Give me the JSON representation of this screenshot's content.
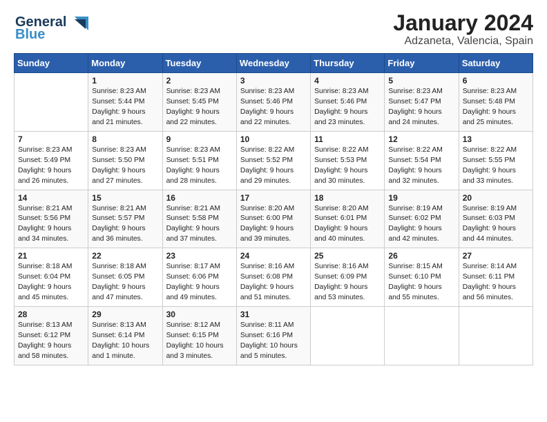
{
  "header": {
    "logo_text_1": "General",
    "logo_text_2": "Blue",
    "month": "January 2024",
    "location": "Adzaneta, Valencia, Spain"
  },
  "weekdays": [
    "Sunday",
    "Monday",
    "Tuesday",
    "Wednesday",
    "Thursday",
    "Friday",
    "Saturday"
  ],
  "weeks": [
    [
      {
        "day": "",
        "info": ""
      },
      {
        "day": "1",
        "info": "Sunrise: 8:23 AM\nSunset: 5:44 PM\nDaylight: 9 hours\nand 21 minutes."
      },
      {
        "day": "2",
        "info": "Sunrise: 8:23 AM\nSunset: 5:45 PM\nDaylight: 9 hours\nand 22 minutes."
      },
      {
        "day": "3",
        "info": "Sunrise: 8:23 AM\nSunset: 5:46 PM\nDaylight: 9 hours\nand 22 minutes."
      },
      {
        "day": "4",
        "info": "Sunrise: 8:23 AM\nSunset: 5:46 PM\nDaylight: 9 hours\nand 23 minutes."
      },
      {
        "day": "5",
        "info": "Sunrise: 8:23 AM\nSunset: 5:47 PM\nDaylight: 9 hours\nand 24 minutes."
      },
      {
        "day": "6",
        "info": "Sunrise: 8:23 AM\nSunset: 5:48 PM\nDaylight: 9 hours\nand 25 minutes."
      }
    ],
    [
      {
        "day": "7",
        "info": "Sunrise: 8:23 AM\nSunset: 5:49 PM\nDaylight: 9 hours\nand 26 minutes."
      },
      {
        "day": "8",
        "info": "Sunrise: 8:23 AM\nSunset: 5:50 PM\nDaylight: 9 hours\nand 27 minutes."
      },
      {
        "day": "9",
        "info": "Sunrise: 8:23 AM\nSunset: 5:51 PM\nDaylight: 9 hours\nand 28 minutes."
      },
      {
        "day": "10",
        "info": "Sunrise: 8:22 AM\nSunset: 5:52 PM\nDaylight: 9 hours\nand 29 minutes."
      },
      {
        "day": "11",
        "info": "Sunrise: 8:22 AM\nSunset: 5:53 PM\nDaylight: 9 hours\nand 30 minutes."
      },
      {
        "day": "12",
        "info": "Sunrise: 8:22 AM\nSunset: 5:54 PM\nDaylight: 9 hours\nand 32 minutes."
      },
      {
        "day": "13",
        "info": "Sunrise: 8:22 AM\nSunset: 5:55 PM\nDaylight: 9 hours\nand 33 minutes."
      }
    ],
    [
      {
        "day": "14",
        "info": "Sunrise: 8:21 AM\nSunset: 5:56 PM\nDaylight: 9 hours\nand 34 minutes."
      },
      {
        "day": "15",
        "info": "Sunrise: 8:21 AM\nSunset: 5:57 PM\nDaylight: 9 hours\nand 36 minutes."
      },
      {
        "day": "16",
        "info": "Sunrise: 8:21 AM\nSunset: 5:58 PM\nDaylight: 9 hours\nand 37 minutes."
      },
      {
        "day": "17",
        "info": "Sunrise: 8:20 AM\nSunset: 6:00 PM\nDaylight: 9 hours\nand 39 minutes."
      },
      {
        "day": "18",
        "info": "Sunrise: 8:20 AM\nSunset: 6:01 PM\nDaylight: 9 hours\nand 40 minutes."
      },
      {
        "day": "19",
        "info": "Sunrise: 8:19 AM\nSunset: 6:02 PM\nDaylight: 9 hours\nand 42 minutes."
      },
      {
        "day": "20",
        "info": "Sunrise: 8:19 AM\nSunset: 6:03 PM\nDaylight: 9 hours\nand 44 minutes."
      }
    ],
    [
      {
        "day": "21",
        "info": "Sunrise: 8:18 AM\nSunset: 6:04 PM\nDaylight: 9 hours\nand 45 minutes."
      },
      {
        "day": "22",
        "info": "Sunrise: 8:18 AM\nSunset: 6:05 PM\nDaylight: 9 hours\nand 47 minutes."
      },
      {
        "day": "23",
        "info": "Sunrise: 8:17 AM\nSunset: 6:06 PM\nDaylight: 9 hours\nand 49 minutes."
      },
      {
        "day": "24",
        "info": "Sunrise: 8:16 AM\nSunset: 6:08 PM\nDaylight: 9 hours\nand 51 minutes."
      },
      {
        "day": "25",
        "info": "Sunrise: 8:16 AM\nSunset: 6:09 PM\nDaylight: 9 hours\nand 53 minutes."
      },
      {
        "day": "26",
        "info": "Sunrise: 8:15 AM\nSunset: 6:10 PM\nDaylight: 9 hours\nand 55 minutes."
      },
      {
        "day": "27",
        "info": "Sunrise: 8:14 AM\nSunset: 6:11 PM\nDaylight: 9 hours\nand 56 minutes."
      }
    ],
    [
      {
        "day": "28",
        "info": "Sunrise: 8:13 AM\nSunset: 6:12 PM\nDaylight: 9 hours\nand 58 minutes."
      },
      {
        "day": "29",
        "info": "Sunrise: 8:13 AM\nSunset: 6:14 PM\nDaylight: 10 hours\nand 1 minute."
      },
      {
        "day": "30",
        "info": "Sunrise: 8:12 AM\nSunset: 6:15 PM\nDaylight: 10 hours\nand 3 minutes."
      },
      {
        "day": "31",
        "info": "Sunrise: 8:11 AM\nSunset: 6:16 PM\nDaylight: 10 hours\nand 5 minutes."
      },
      {
        "day": "",
        "info": ""
      },
      {
        "day": "",
        "info": ""
      },
      {
        "day": "",
        "info": ""
      }
    ]
  ]
}
